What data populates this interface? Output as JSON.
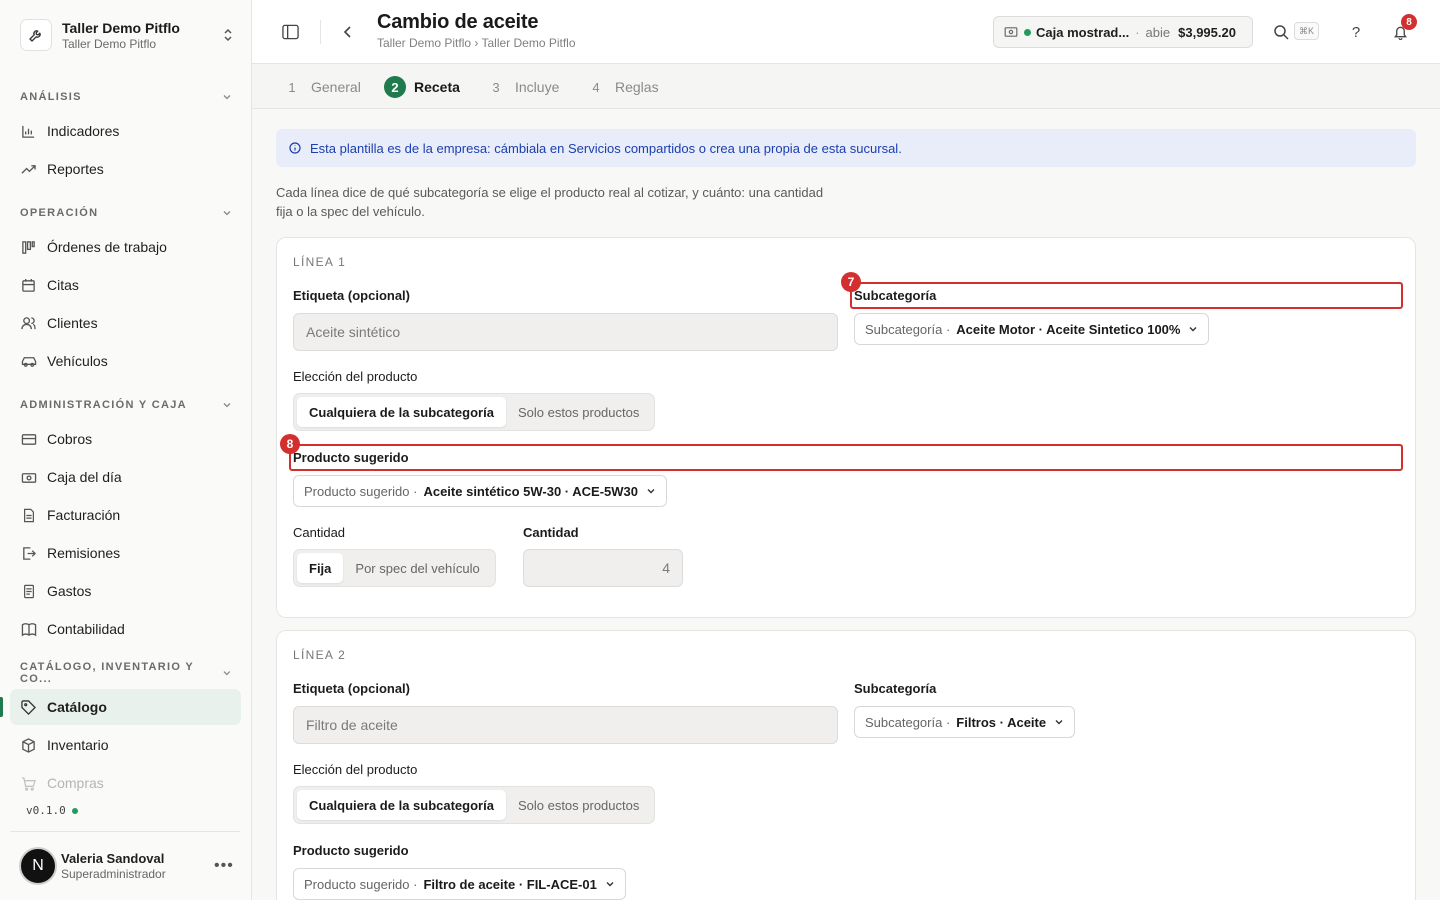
{
  "org": {
    "name": "Taller Demo Pitflo",
    "sub": "Taller Demo Pitflo"
  },
  "sidebar": {
    "sections": [
      {
        "label": "ANÁLISIS"
      },
      {
        "label": "OPERACIÓN"
      },
      {
        "label": "ADMINISTRACIÓN Y CAJA"
      },
      {
        "label": "CATÁLOGO, INVENTARIO Y CO..."
      }
    ],
    "items": [
      {
        "label": "Indicadores",
        "icon": "bar-chart-icon"
      },
      {
        "label": "Reportes",
        "icon": "trending-up-icon"
      },
      {
        "label": "Órdenes de trabajo",
        "icon": "kanban-icon"
      },
      {
        "label": "Citas",
        "icon": "calendar-icon"
      },
      {
        "label": "Clientes",
        "icon": "users-icon"
      },
      {
        "label": "Vehículos",
        "icon": "car-icon"
      },
      {
        "label": "Cobros",
        "icon": "credit-card-icon"
      },
      {
        "label": "Caja del día",
        "icon": "cash-icon"
      },
      {
        "label": "Facturación",
        "icon": "file-text-icon"
      },
      {
        "label": "Remisiones",
        "icon": "file-export-icon"
      },
      {
        "label": "Gastos",
        "icon": "receipt-icon"
      },
      {
        "label": "Contabilidad",
        "icon": "book-icon"
      },
      {
        "label": "Catálogo",
        "icon": "tag-icon"
      },
      {
        "label": "Inventario",
        "icon": "box-icon"
      },
      {
        "label": "Compras",
        "icon": "cart-icon"
      }
    ],
    "version": "v0.1.0"
  },
  "user": {
    "initial": "N",
    "name": "Valeria Sandoval",
    "role": "Superadministrador"
  },
  "header": {
    "title": "Cambio de aceite",
    "breadcrumb": "Taller Demo Pitflo › Taller Demo Pitflo",
    "cash": {
      "name": "Caja mostrad...",
      "sep": "·",
      "state": "abie",
      "amount": "$3,995.20"
    },
    "shortcut": "⌘K",
    "help": "?",
    "notifications": "8"
  },
  "tabs": [
    {
      "num": "1",
      "label": "General"
    },
    {
      "num": "2",
      "label": "Receta"
    },
    {
      "num": "3",
      "label": "Incluye"
    },
    {
      "num": "4",
      "label": "Reglas"
    }
  ],
  "alert": "Esta plantilla es de la empresa: cámbiala en Servicios compartidos o crea una propia de esta sucursal.",
  "intro": "Cada línea dice de qué subcategoría se elige el producto real al cotizar, y cuánto: una cantidad fija o la spec del vehículo.",
  "lines": [
    {
      "title": "LÍNEA 1",
      "label_label": "Etiqueta (opcional)",
      "label_value": "Aceite sintético",
      "subcat_label": "Subcategoría",
      "subcat_prefix": "Subcategoría ·",
      "subcat_value": "Aceite Motor · Aceite Sintetico 100%",
      "choice_label": "Elección del producto",
      "choice_opt1": "Cualquiera de la subcategoría",
      "choice_opt2": "Solo estos productos",
      "product_label": "Producto sugerido",
      "product_prefix": "Producto sugerido ·",
      "product_value": "Aceite sintético 5W-30 · ACE-5W30",
      "qty_mode_label": "Cantidad",
      "qty_opt1": "Fija",
      "qty_opt2": "Por spec del vehículo",
      "qty_label": "Cantidad",
      "qty_value": "4"
    },
    {
      "title": "LÍNEA 2",
      "label_label": "Etiqueta (opcional)",
      "label_value": "Filtro de aceite",
      "subcat_label": "Subcategoría",
      "subcat_prefix": "Subcategoría ·",
      "subcat_value": "Filtros · Aceite",
      "choice_label": "Elección del producto",
      "choice_opt1": "Cualquiera de la subcategoría",
      "choice_opt2": "Solo estos productos",
      "product_label": "Producto sugerido",
      "product_prefix": "Producto sugerido ·",
      "product_value": "Filtro de aceite · FIL-ACE-01"
    }
  ],
  "annotations": [
    {
      "num": "7"
    },
    {
      "num": "8"
    }
  ],
  "colors": {
    "accent": "#1f7a4d",
    "highlight": "#d32f2f",
    "alert_text": "#1b3fae"
  }
}
